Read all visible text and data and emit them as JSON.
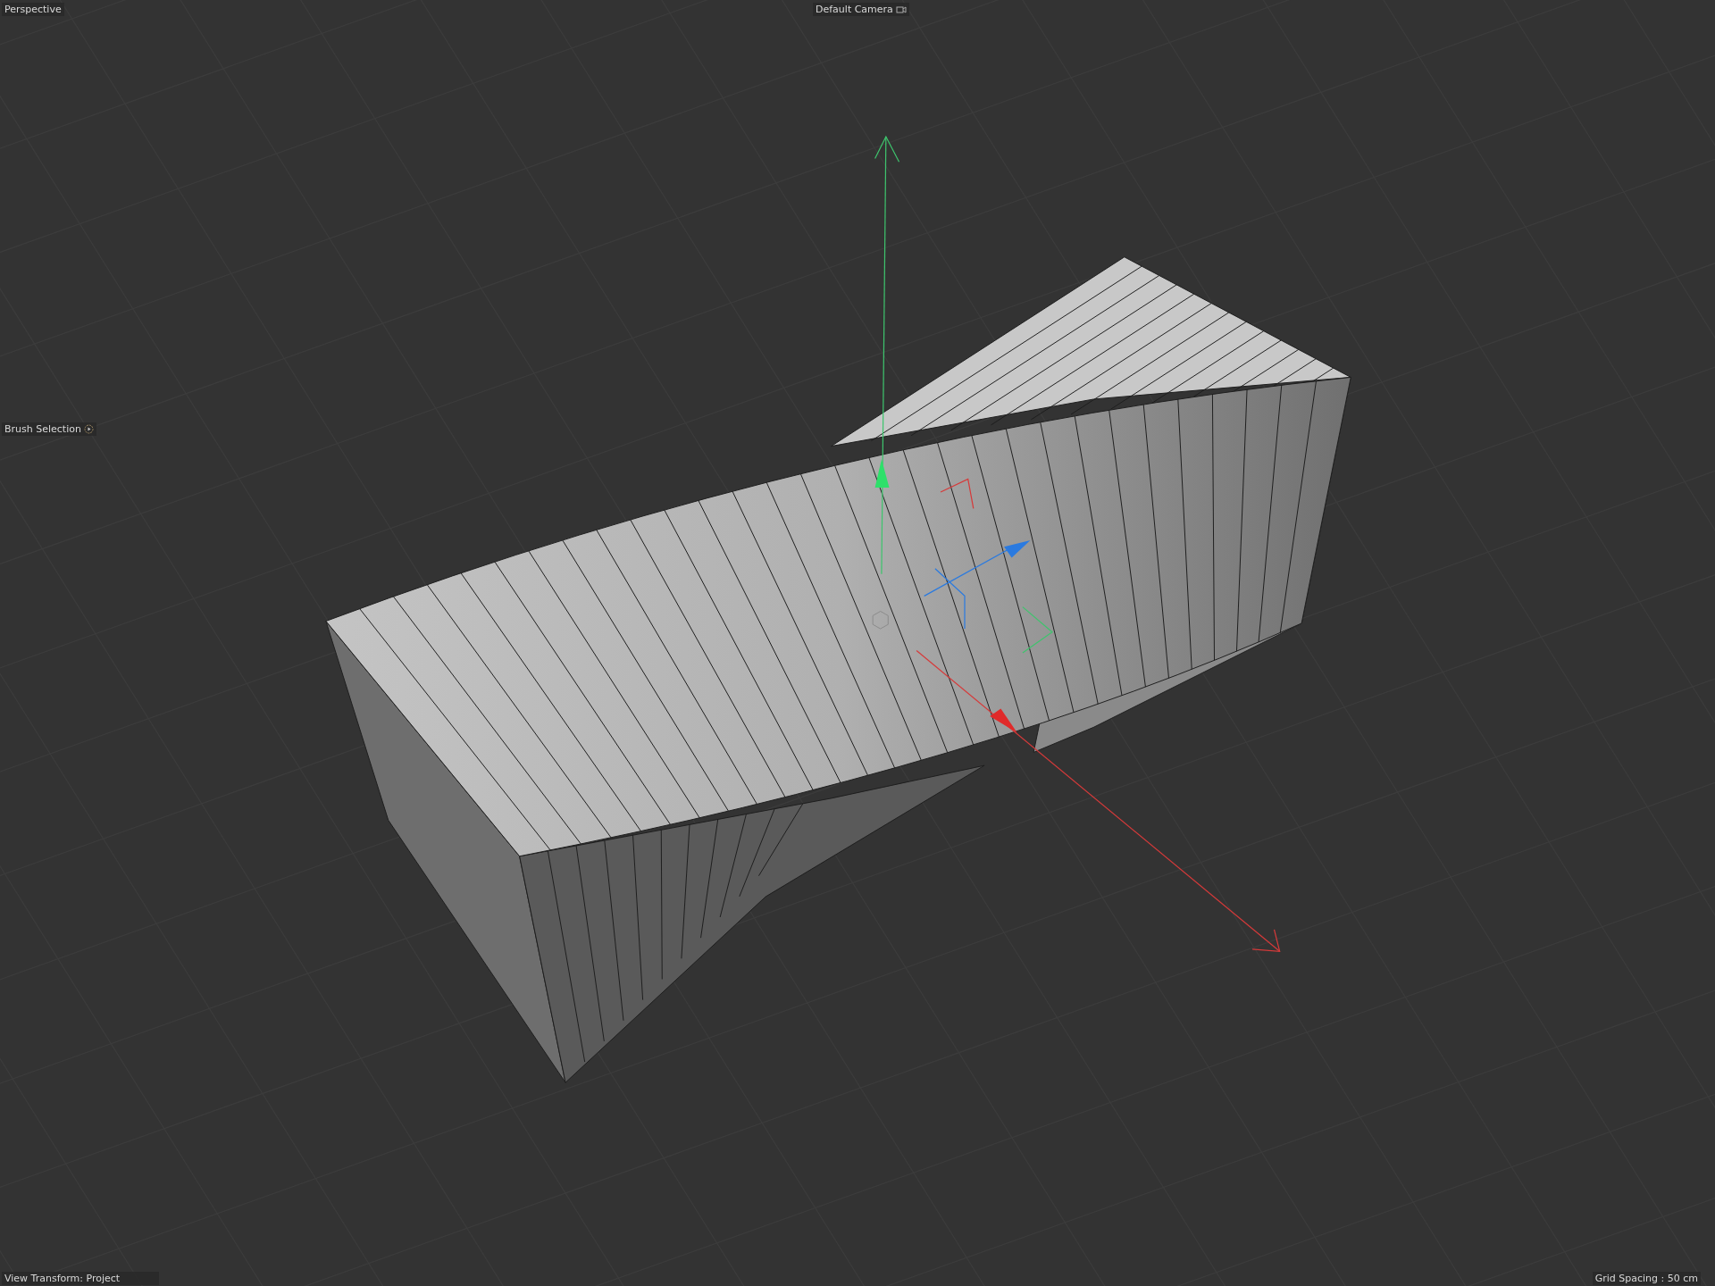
{
  "viewport": {
    "projection": "Perspective",
    "camera": "Default Camera",
    "tool": "Brush Selection",
    "view_transform": "View Transform: Project",
    "grid_spacing": "Grid Spacing : 50 cm"
  }
}
